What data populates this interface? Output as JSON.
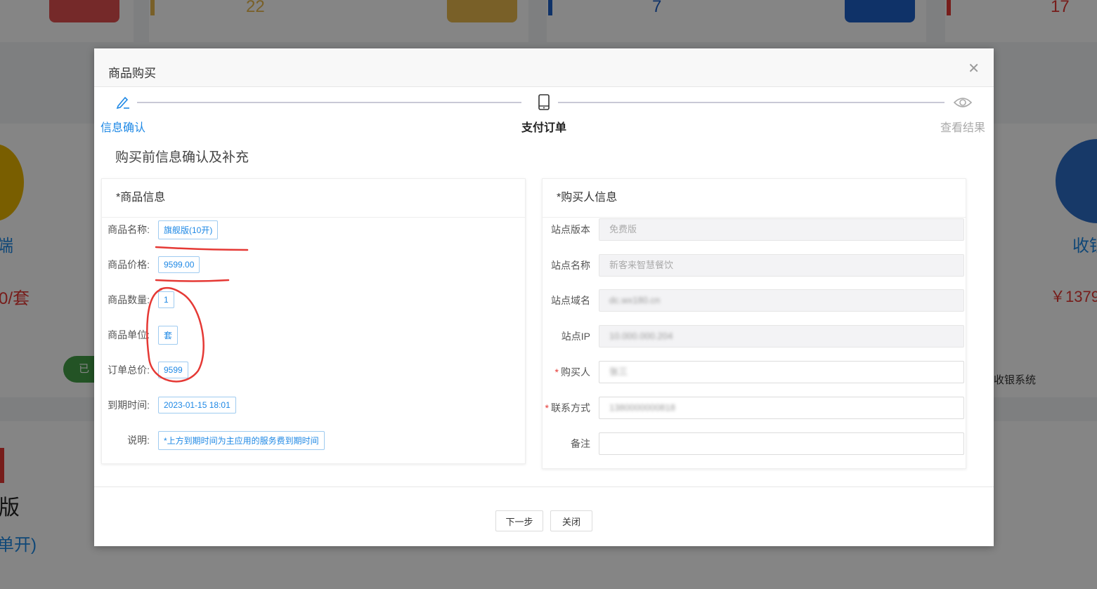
{
  "background": {
    "stats": [
      "22",
      "7",
      "17"
    ],
    "left_text": {
      "price": "0/套",
      "label_a": "端",
      "label_b": "已",
      "version": "版",
      "single": "单开)"
    },
    "right_text": {
      "product": "收银",
      "price": "￥1379",
      "system": "收银系统"
    }
  },
  "modal": {
    "title": "商品购买",
    "close_icon": "close-icon",
    "steps": [
      {
        "label": "信息确认",
        "icon": "pencil-icon",
        "state": "active"
      },
      {
        "label": "支付订单",
        "icon": "tablet-icon",
        "state": "current"
      },
      {
        "label": "查看结果",
        "icon": "eye-icon",
        "state": "pending"
      }
    ],
    "section_title": "购买前信息确认及补充",
    "product_panel": {
      "title": "*商品信息",
      "rows": [
        {
          "label": "商品名称:",
          "value": "旗舰版(10开)"
        },
        {
          "label": "商品价格:",
          "value": "9599.00"
        },
        {
          "label": "商品数量:",
          "value": "1"
        },
        {
          "label": "商品单位:",
          "value": "套"
        },
        {
          "label": "订单总价:",
          "value": "9599"
        },
        {
          "label": "到期时间:",
          "value": "2023-01-15 18:01"
        },
        {
          "label": "说明:",
          "value": "*上方到期时间为主应用的服务费到期时间"
        }
      ]
    },
    "buyer_panel": {
      "title": "*购买人信息",
      "fields": [
        {
          "label": "站点版本",
          "value": "免费版",
          "required": false,
          "disabled": true
        },
        {
          "label": "站点名称",
          "value": "新客来智慧餐饮",
          "required": false,
          "disabled": true
        },
        {
          "label": "站点域名",
          "value": "dc.wx180.cn",
          "required": false,
          "disabled": true
        },
        {
          "label": "站点IP",
          "value": "10.000.000.204",
          "required": false,
          "disabled": true
        },
        {
          "label": "购买人",
          "value": "张三",
          "required": true,
          "disabled": false
        },
        {
          "label": "联系方式",
          "value": "1380000000818",
          "required": true,
          "disabled": false
        },
        {
          "label": "备注",
          "value": "",
          "required": false,
          "disabled": false
        }
      ]
    },
    "buttons": {
      "next": "下一步",
      "close": "关闭"
    },
    "colors": {
      "accent": "#1e88e5",
      "annotation": "#e53935"
    }
  }
}
